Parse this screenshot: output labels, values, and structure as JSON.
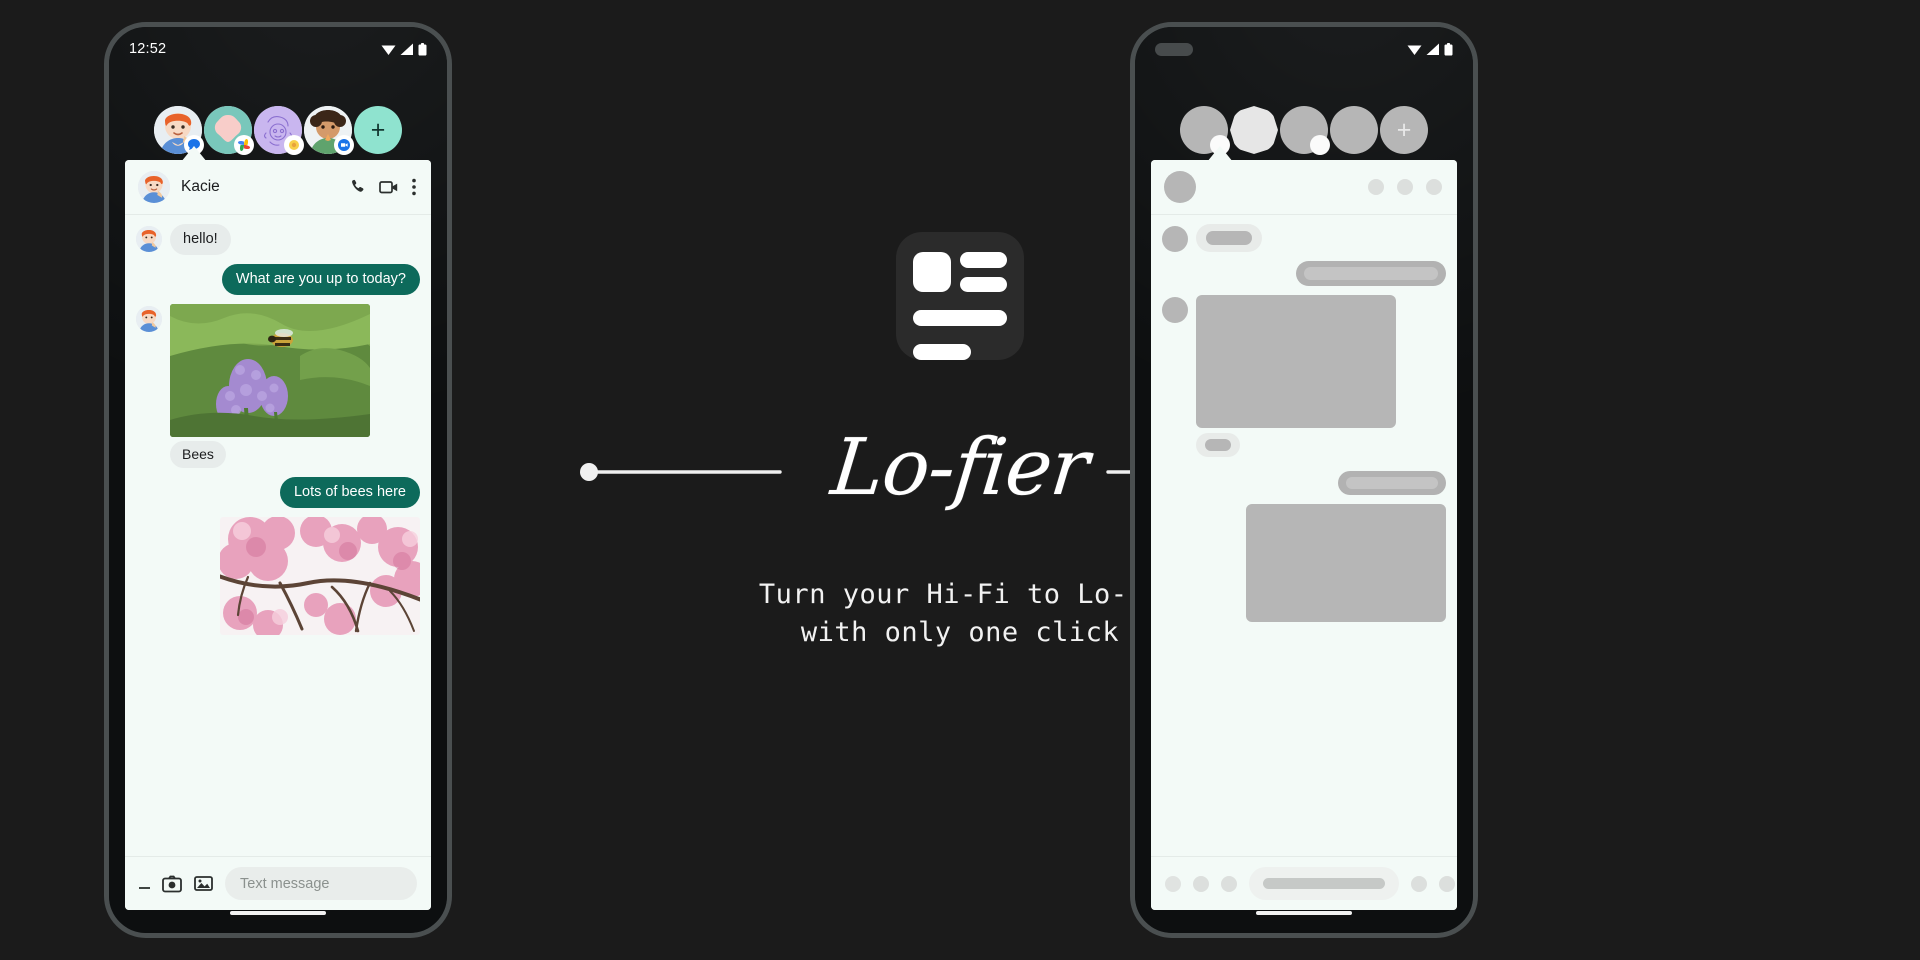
{
  "page": {
    "background_color": "#1b1b1b",
    "accent_teal": "#0d6a5b",
    "panel_bg": "#f3faf7",
    "placeholder_gray": "#b6b6b6"
  },
  "brand": {
    "wordmark": "Lo-fier",
    "tagline": "Turn your Hi-Fi to Lo-Fi\nwith only one click",
    "logo_name": "lofier-logo"
  },
  "left_phone": {
    "label": "hi-fi-phone",
    "statusbar": {
      "clock": "12:52",
      "icons": [
        "wifi-icon",
        "signal-icon",
        "battery-icon"
      ]
    },
    "bubble_row": {
      "items": [
        {
          "name": "bubble-avatar-kacie",
          "badge": "messages-icon",
          "selected": true
        },
        {
          "name": "bubble-avatar-2",
          "badge": "photos-icon",
          "selected": false
        },
        {
          "name": "bubble-avatar-3",
          "badge": "sticker-icon",
          "selected": false
        },
        {
          "name": "bubble-avatar-4",
          "badge": "duo-icon",
          "selected": false
        }
      ],
      "add_label": "+"
    },
    "chat": {
      "contact_name": "Kacie",
      "actions": [
        "phone-icon",
        "video-camera-icon",
        "overflow-menu-icon"
      ],
      "messages": [
        {
          "type": "text",
          "side": "in",
          "text": "hello!"
        },
        {
          "type": "text",
          "side": "out",
          "text": "What are you up to today?"
        },
        {
          "type": "image",
          "side": "in",
          "alt": "bees-on-purple-flowers",
          "caption": "Bees"
        },
        {
          "type": "text",
          "side": "out",
          "text": "Lots of bees here"
        },
        {
          "type": "image",
          "side": "out",
          "alt": "pink-cherry-blossoms"
        }
      ],
      "composer": {
        "placeholder": "Text message",
        "icons": [
          "dash-icon",
          "camera-icon",
          "gallery-icon"
        ]
      }
    },
    "nav": {
      "icons": [
        "assistant-icon",
        "mic-icon",
        "lens-icon"
      ]
    }
  },
  "right_phone": {
    "label": "lo-fi-wireframe-phone",
    "statusbar": {
      "clock": "",
      "icons": [
        "wifi-icon",
        "signal-icon",
        "battery-icon"
      ]
    },
    "bubble_row": {
      "items": [
        {
          "name": "bubble-avatar-placeholder-1",
          "selected": true
        },
        {
          "name": "bubble-avatar-placeholder-2",
          "selected": false
        },
        {
          "name": "bubble-avatar-placeholder-3",
          "selected": false
        },
        {
          "name": "bubble-avatar-placeholder-4",
          "selected": false
        }
      ],
      "add_label": "+"
    },
    "chat": {
      "contact_name": "",
      "messages": [
        {
          "type": "text",
          "side": "in",
          "text": ""
        },
        {
          "type": "text",
          "side": "out",
          "text": ""
        },
        {
          "type": "image",
          "side": "in",
          "alt": "image-placeholder",
          "caption": ""
        },
        {
          "type": "text",
          "side": "out",
          "text": ""
        },
        {
          "type": "image",
          "side": "out",
          "alt": "image-placeholder"
        }
      ],
      "composer": {
        "placeholder": ""
      }
    },
    "nav": {
      "icons": [
        "assistant-icon",
        "mic-icon",
        "lens-icon"
      ]
    }
  }
}
